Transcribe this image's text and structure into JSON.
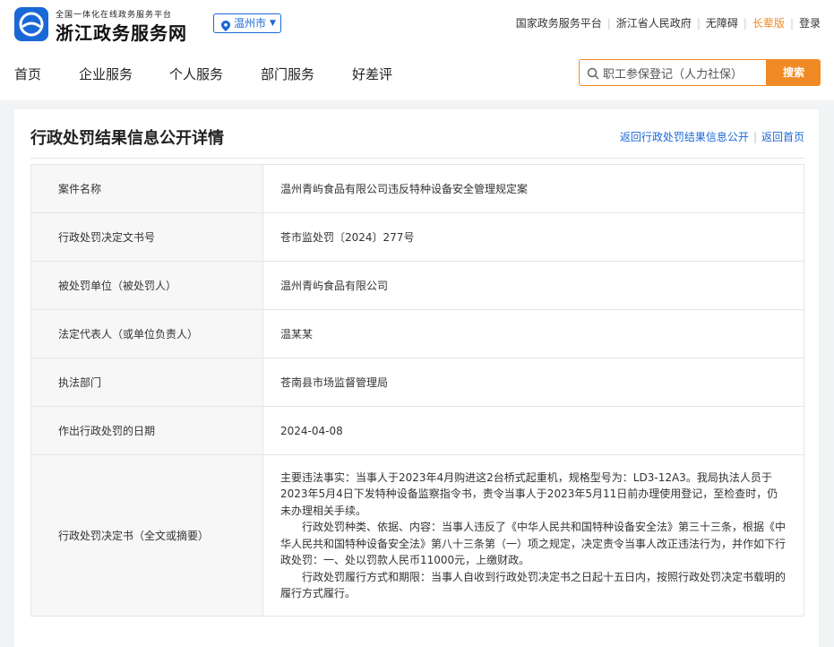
{
  "header": {
    "logo_subtitle": "全国一体化在线政务服务平台",
    "logo_title": "浙江政务服务网",
    "city": "温州市",
    "top_links": [
      "国家政务服务平台",
      "浙江省人民政府",
      "无障碍",
      "长辈版",
      "登录"
    ]
  },
  "nav": {
    "items": [
      "首页",
      "企业服务",
      "个人服务",
      "部门服务",
      "好差评"
    ]
  },
  "search": {
    "value": "职工参保登记（人力社保）",
    "button": "搜索"
  },
  "page": {
    "title": "行政处罚结果信息公开详情",
    "back_link": "返回行政处罚结果信息公开",
    "home_link": "返回首页"
  },
  "details": [
    {
      "label": "案件名称",
      "value": "温州青屿食品有限公司违反特种设备安全管理规定案"
    },
    {
      "label": "行政处罚决定文书号",
      "value": "苍市监处罚〔2024〕277号"
    },
    {
      "label": "被处罚单位（被处罚人）",
      "value": "温州青屿食品有限公司"
    },
    {
      "label": "法定代表人（或单位负责人）",
      "value": "温某某"
    },
    {
      "label": "执法部门",
      "value": "苍南县市场监督管理局"
    },
    {
      "label": "作出行政处罚的日期",
      "value": "2024-04-08"
    }
  ],
  "decision": {
    "label": "行政处罚决定书（全文或摘要）",
    "paragraphs": [
      "主要违法事实：当事人于2023年4月购进这2台桥式起重机，规格型号为：LD3-12A3。我局执法人员于2023年5月4日下发特种设备监察指令书，责令当事人于2023年5月11日前办理使用登记，至检查时，仍未办理相关手续。",
      "行政处罚种类、依据、内容：当事人违反了《中华人民共和国特种设备安全法》第三十三条，根据《中华人民共和国特种设备安全法》第八十三条第（一）项之规定，决定责令当事人改正违法行为，并作如下行政处罚：一、处以罚款人民币11000元，上缴财政。",
      "行政处罚履行方式和期限：当事人自收到行政处罚决定书之日起十五日内，按照行政处罚决定书载明的履行方式履行。"
    ]
  },
  "colors": {
    "brand_blue": "#1a68d6",
    "accent_orange": "#f08a24"
  }
}
